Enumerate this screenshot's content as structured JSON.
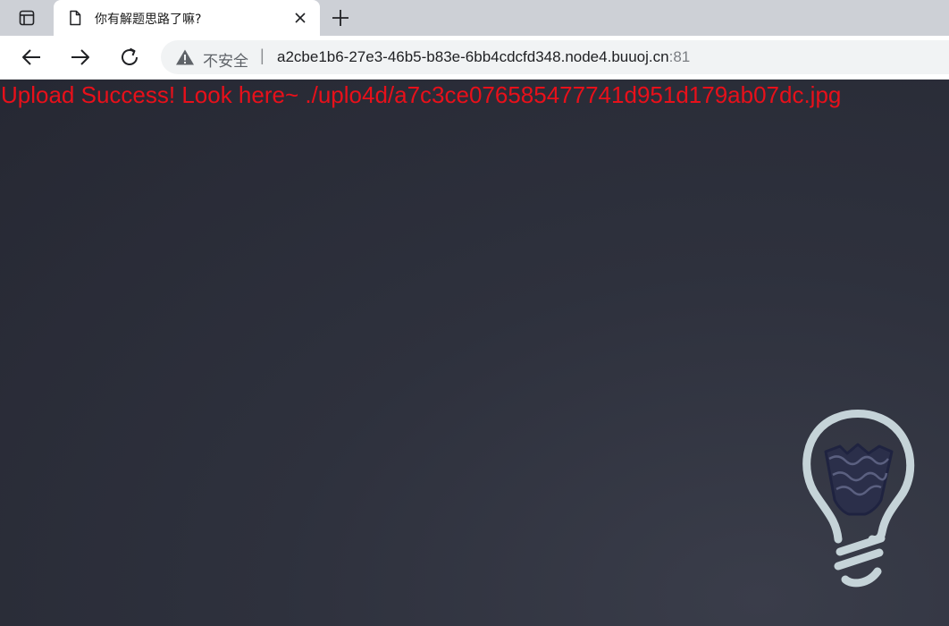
{
  "browser": {
    "tab": {
      "title": "你有解题思路了嘛?",
      "favicon": "page-icon"
    },
    "toolbar": {
      "back_icon": "back-arrow-icon",
      "forward_icon": "forward-arrow-icon",
      "reload_icon": "reload-icon"
    },
    "omnibox": {
      "security_icon": "warning-triangle-icon",
      "security_label": "不安全",
      "separator": "|",
      "host": "a2cbe1b6-27e3-46b5-b83e-6bb4cdcfd348.node4.buuoj.cn",
      "port": ":81"
    }
  },
  "page": {
    "message": "Upload Success! Look here~ ./uplo4d/a7c3ce076585477741d951d179ab07dc.jpg",
    "message_color": "#e8101a",
    "background_color": "#2a2d38",
    "bulb_icon": "lightbulb-icon"
  }
}
